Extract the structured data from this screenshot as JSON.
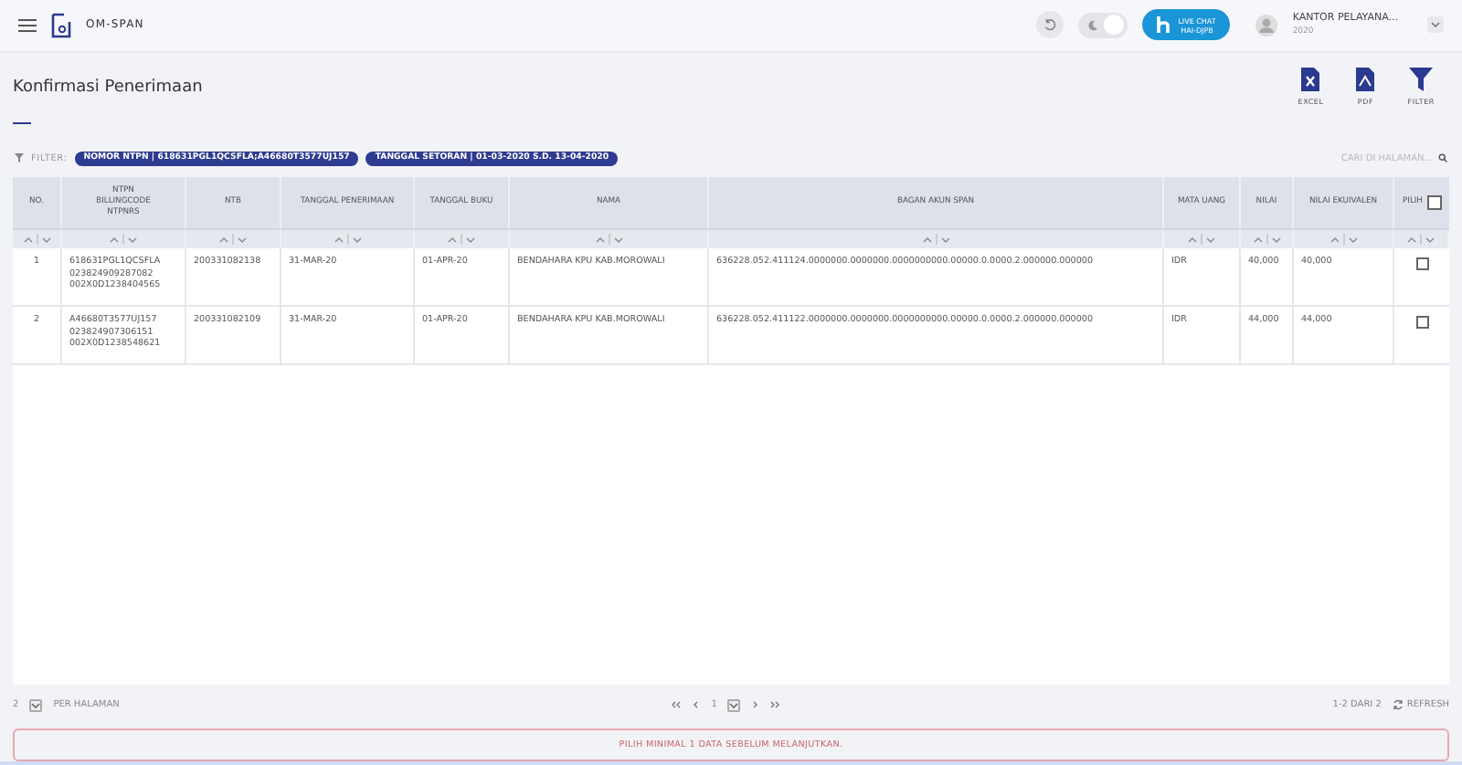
{
  "header": {
    "app_name": "OM-SPAN",
    "dark_mode": true,
    "live_chat": [
      "LIVE CHAT",
      "HAI-DJPB"
    ],
    "user": {
      "office": "KANTOR PELAYANA...",
      "year": "2020"
    }
  },
  "page": {
    "title": "Konfirmasi Penerimaan",
    "actions": [
      {
        "kind": "excel",
        "label": "EXCEL"
      },
      {
        "kind": "pdf",
        "label": "PDF"
      },
      {
        "kind": "filter",
        "label": "FILTER"
      }
    ]
  },
  "filter": {
    "label": "FILTER:",
    "chips": [
      "NOMOR NTPN | 618631PGL1QCSFLA;A46680T3577UJ157",
      "TANGGAL SETORAN | 01-03-2020 S.D. 13-04-2020"
    ],
    "search_placeholder": "CARI DI HALAMAN..."
  },
  "table": {
    "columns": [
      {
        "label": [
          "NO."
        ]
      },
      {
        "label": [
          "NTPN",
          "BILLINGCODE",
          "NTPNRS"
        ]
      },
      {
        "label": [
          "NTB"
        ]
      },
      {
        "label": [
          "TANGGAL PENERIMAAN"
        ]
      },
      {
        "label": [
          "TANGGAL BUKU"
        ]
      },
      {
        "label": [
          "NAMA"
        ]
      },
      {
        "label": [
          "BAGAN AKUN SPAN"
        ]
      },
      {
        "label": [
          "MATA UANG"
        ]
      },
      {
        "label": [
          "NILAI"
        ]
      },
      {
        "label": [
          "NILAI EKUIVALEN"
        ]
      },
      {
        "label": [
          "PILIH"
        ],
        "checked": false
      }
    ],
    "rows": [
      {
        "no": "1",
        "ntpn": [
          "618631PGL1QCSFLA",
          "023824909287082",
          "002X0D1238404565"
        ],
        "ntb": "200331082138",
        "tanggal_penerimaan": "31-MAR-20",
        "tanggal_buku": "01-APR-20",
        "nama": "BENDAHARA KPU KAB.MOROWALI",
        "bagan_akun": "636228.052.411124.0000000.0000000.0000000000.00000.0.0000.2.000000.000000",
        "mata_uang": "IDR",
        "nilai": "40,000",
        "nilai_ekuivalen": "40,000",
        "checked": false
      },
      {
        "no": "2",
        "ntpn": [
          "A46680T3577UJ157",
          "023824907306151",
          "002X0D1238548621"
        ],
        "ntb": "200331082109",
        "tanggal_penerimaan": "31-MAR-20",
        "tanggal_buku": "01-APR-20",
        "nama": "BENDAHARA KPU KAB.MOROWALI",
        "bagan_akun": "636228.052.411122.0000000.0000000.0000000000.00000.0.0000.2.000000.000000",
        "mata_uang": "IDR",
        "nilai": "44,000",
        "nilai_ekuivalen": "44,000",
        "checked": false
      }
    ]
  },
  "footer": {
    "per_page": "2",
    "per_page_label": "PER HALAMAN",
    "page": "1",
    "range": "1-2 DARI 2",
    "refresh": "REFRESH"
  },
  "alert": "PILIH MINIMAL 1 DATA SEBELUM MELANJUTKAN."
}
